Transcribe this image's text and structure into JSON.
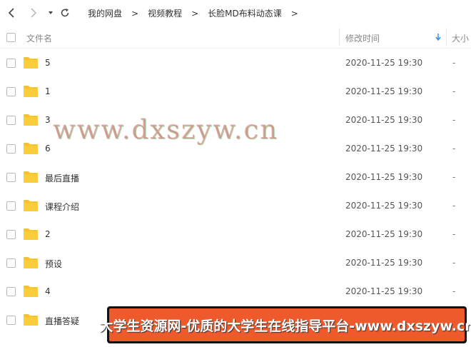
{
  "breadcrumb": [
    "我的网盘",
    "视频教程",
    "长脸MD布料动态课"
  ],
  "breadcrumb_separator": ">",
  "columns": {
    "name": "文件名",
    "modified": "修改时间",
    "size": "大小"
  },
  "files": [
    {
      "name": "5",
      "modified": "2020-11-25 19:30",
      "size": "-"
    },
    {
      "name": "1",
      "modified": "2020-11-25 19:30",
      "size": "-"
    },
    {
      "name": "3",
      "modified": "2020-11-25 19:30",
      "size": "-"
    },
    {
      "name": "6",
      "modified": "2020-11-25 19:30",
      "size": "-"
    },
    {
      "name": "最后直播",
      "modified": "2020-11-25 19:30",
      "size": "-"
    },
    {
      "name": "课程介绍",
      "modified": "2020-11-25 19:30",
      "size": "-"
    },
    {
      "name": "2",
      "modified": "2020-11-25 19:30",
      "size": "-"
    },
    {
      "name": "预设",
      "modified": "2020-11-25 19:30",
      "size": "-"
    },
    {
      "name": "4",
      "modified": "2020-11-25 19:30",
      "size": "-"
    },
    {
      "name": "直播答疑",
      "modified": "",
      "size": ""
    }
  ],
  "watermark": "www.dxszyw.cn",
  "banner": "大学生资源网-优质的大学生在线指导平台-www.dxszyw.cn",
  "colors": {
    "folder": "#f7c331",
    "folder_tab": "#eab01f",
    "sort_arrow": "#3a8ee6",
    "banner_bg": "#ee5a2c"
  },
  "icons": {
    "back": "chevron-left-icon",
    "forward": "chevron-right-icon",
    "history": "caret-down-icon",
    "refresh": "refresh-icon",
    "folder": "folder-icon",
    "sort": "sort-down-arrow-icon"
  }
}
